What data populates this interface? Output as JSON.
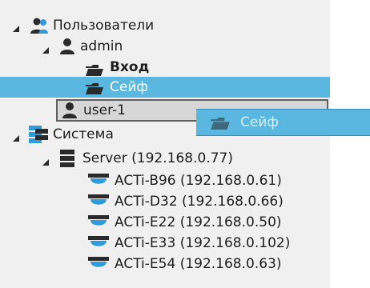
{
  "tree": {
    "users": "Пользователи",
    "admin": "admin",
    "entry": "Вход",
    "safe": "Сейф",
    "user1": "user-1",
    "system": "Система",
    "server": "Server (192.168.0.77)",
    "cams": [
      "ACTi-B96 (192.168.0.61)",
      "ACTi-D32 (192.168.0.66)",
      "ACTi-E22 (192.168.0.50)",
      "ACTi-E33 (192.168.0.102)",
      "ACTi-E54 (192.168.0.63)"
    ]
  },
  "drag": {
    "label": "Сейф"
  },
  "colors": {
    "accent": "#5ab7e0",
    "tree_bg": "#f0f0f0",
    "text": "#1e1e1e"
  },
  "icons": {
    "users_group": "users-icon",
    "user": "user-icon",
    "folder": "folder-icon",
    "server_rack": "server-icon",
    "camera": "dome-camera-icon"
  }
}
